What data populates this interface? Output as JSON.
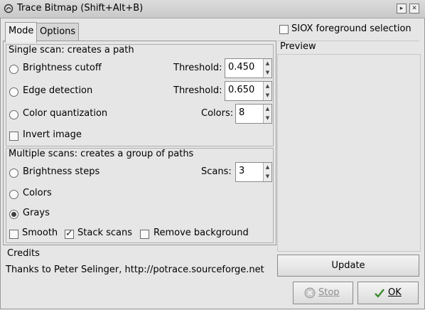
{
  "window": {
    "title": "Trace Bitmap (Shift+Alt+B)",
    "icon": "inkscape-trace-icon",
    "buttons": [
      "shade-icon",
      "close-icon"
    ]
  },
  "tabs": [
    {
      "label": "Mode",
      "active": true
    },
    {
      "label": "Options",
      "active": false
    }
  ],
  "single_scan": {
    "title": "Single scan: creates a path",
    "options": [
      {
        "label": "Brightness cutoff",
        "selected": false,
        "param_label": "Threshold:",
        "param_value": "0.450"
      },
      {
        "label": "Edge detection",
        "selected": false,
        "param_label": "Threshold:",
        "param_value": "0.650"
      },
      {
        "label": "Color quantization",
        "selected": false,
        "param_label": "Colors:",
        "param_value": "8"
      }
    ],
    "invert": {
      "label": "Invert image",
      "checked": false
    }
  },
  "multi_scan": {
    "title": "Multiple scans: creates a group of paths",
    "options": [
      {
        "label": "Brightness steps",
        "selected": false
      },
      {
        "label": "Colors",
        "selected": false
      },
      {
        "label": "Grays",
        "selected": true
      }
    ],
    "scans_label": "Scans:",
    "scans_value": "3",
    "checks": [
      {
        "label": "Smooth",
        "checked": false
      },
      {
        "label": "Stack scans",
        "checked": true
      },
      {
        "label": "Remove background",
        "checked": false
      }
    ]
  },
  "siox": {
    "label": "SIOX foreground selection",
    "checked": false
  },
  "preview": {
    "title": "Preview",
    "update_label": "Update"
  },
  "credits": {
    "title": "Credits",
    "text": "Thanks to Peter Selinger, http://potrace.sourceforge.net"
  },
  "actions": {
    "stop_label": "Stop",
    "ok_label": "OK",
    "stop_enabled": false
  }
}
